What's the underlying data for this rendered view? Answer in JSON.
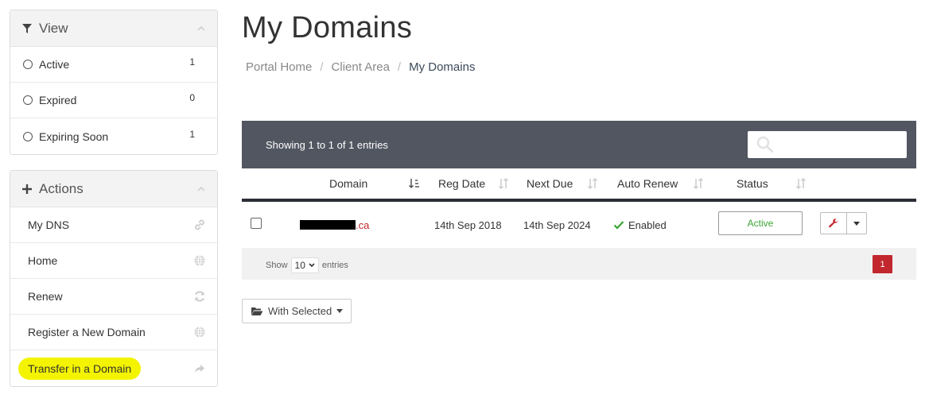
{
  "view_panel": {
    "title": "View",
    "items": [
      {
        "label": "Active",
        "count": "1"
      },
      {
        "label": "Expired",
        "count": "0"
      },
      {
        "label": "Expiring Soon",
        "count": "1"
      }
    ]
  },
  "actions_panel": {
    "title": "Actions",
    "items": [
      {
        "label": "My DNS",
        "icon": "link-icon"
      },
      {
        "label": "Home",
        "icon": "globe-icon"
      },
      {
        "label": "Renew",
        "icon": "refresh-icon"
      },
      {
        "label": "Register a New Domain",
        "icon": "globe-icon"
      },
      {
        "label": "Transfer in a Domain",
        "icon": "share-icon"
      }
    ],
    "highlight_color": "#f4f400"
  },
  "page": {
    "title": "My Domains",
    "breadcrumb": [
      "Portal Home",
      "Client Area",
      "My Domains"
    ]
  },
  "table": {
    "info": "Showing 1 to 1 of 1 entries",
    "search_placeholder": "",
    "columns": [
      "Domain",
      "Reg Date",
      "Next Due",
      "Auto Renew",
      "Status"
    ],
    "rows": [
      {
        "domain_suffix": ".ca",
        "reg_date": "14th Sep 2018",
        "next_due": "14th Sep 2024",
        "auto_renew": "Enabled",
        "status": "Active"
      }
    ],
    "footer": {
      "show_label": "Show",
      "page_size": "10",
      "entries_label": "entries",
      "current_page": "1"
    }
  },
  "with_selected": "With Selected",
  "colors": {
    "toolbar_bg": "#525661",
    "accent_red": "#c1272d",
    "status_green": "#3aa635"
  }
}
